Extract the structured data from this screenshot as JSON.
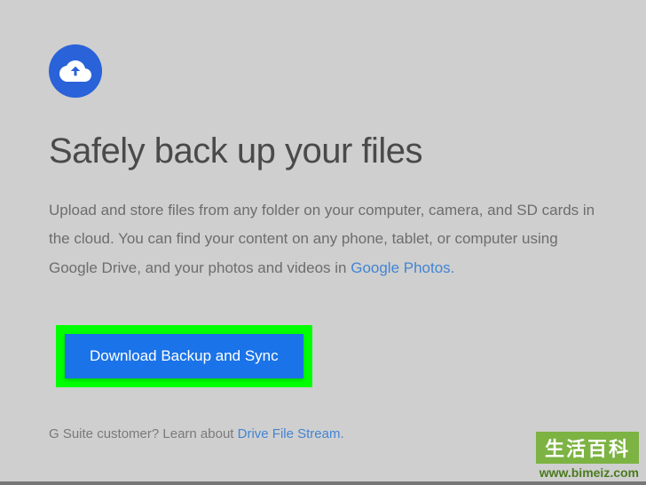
{
  "icon": "cloud-upload-icon",
  "heading": "Safely back up your files",
  "description_part1": "Upload and store files from any folder on your computer, camera, and SD cards in the cloud. You can find your content on any phone, tablet, or computer using Google Drive, and your photos and videos in ",
  "description_link": "Google Photos.",
  "download_button": "Download Backup and Sync",
  "footer_text": "G Suite customer? Learn about ",
  "footer_link": "Drive File Stream.",
  "watermark_text": "生活百科",
  "watermark_url": "www.bimeiz.com",
  "colors": {
    "accent": "#1a73e8",
    "highlight": "#00ff00",
    "link": "#4285d4"
  }
}
